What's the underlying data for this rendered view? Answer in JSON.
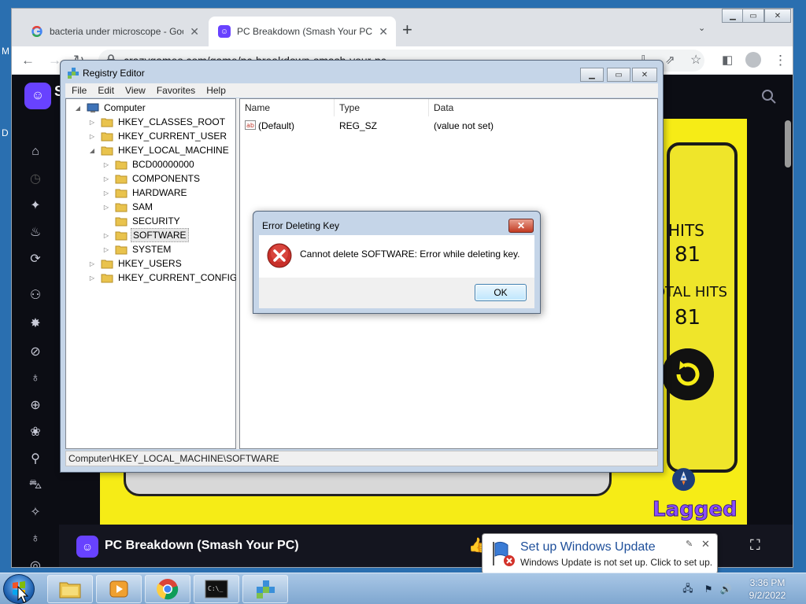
{
  "desktop": {
    "edge_letters": [
      "M",
      "D"
    ]
  },
  "chrome": {
    "tabs": [
      {
        "title": "bacteria under microscope - Goo",
        "icon": "google-icon",
        "active": false
      },
      {
        "title": "PC Breakdown (Smash Your PC) D",
        "icon": "crazygames-icon",
        "active": true
      }
    ],
    "new_tab": "+",
    "url": "crazygames.com/game/pc-breakdown-smash-your-pc"
  },
  "site": {
    "logo_letter": "S",
    "game_title": "PC Breakdown (Smash Your PC)",
    "game": {
      "hits_label": "HITS",
      "hits_value": "81",
      "total_hits_label": "OTAL HITS",
      "total_hits_value": "81",
      "brand": "Lagged"
    }
  },
  "regedit": {
    "title": "Registry Editor",
    "menu": [
      "File",
      "Edit",
      "View",
      "Favorites",
      "Help"
    ],
    "tree": {
      "root": "Computer",
      "hives": [
        "HKEY_CLASSES_ROOT",
        "HKEY_CURRENT_USER",
        "HKEY_LOCAL_MACHINE"
      ],
      "hklm_children": [
        "BCD00000000",
        "COMPONENTS",
        "HARDWARE",
        "SAM",
        "SECURITY",
        "SOFTWARE",
        "SYSTEM"
      ],
      "more_hives": [
        "HKEY_USERS",
        "HKEY_CURRENT_CONFIG"
      ],
      "selected": "SOFTWARE"
    },
    "columns": [
      "Name",
      "Type",
      "Data"
    ],
    "values": [
      {
        "name": "(Default)",
        "type": "REG_SZ",
        "data": "(value not set)"
      }
    ],
    "status": "Computer\\HKEY_LOCAL_MACHINE\\SOFTWARE"
  },
  "error_dialog": {
    "title": "Error Deleting Key",
    "message": "Cannot delete SOFTWARE:  Error while deleting key.",
    "ok_label": "OK"
  },
  "balloon": {
    "title": "Set up Windows Update",
    "text": "Windows Update is not set up. Click to set up."
  },
  "taskbar": {
    "apps": [
      "explorer-icon",
      "media-player-icon",
      "chrome-icon",
      "cmd-icon",
      "regedit-icon"
    ],
    "time": "3:36 PM",
    "date": "9/2/2022"
  },
  "colors": {
    "game_yellow": "#f6ec16",
    "crazygames_purple": "#6842ff",
    "balloon_title": "#1e4f9a"
  }
}
